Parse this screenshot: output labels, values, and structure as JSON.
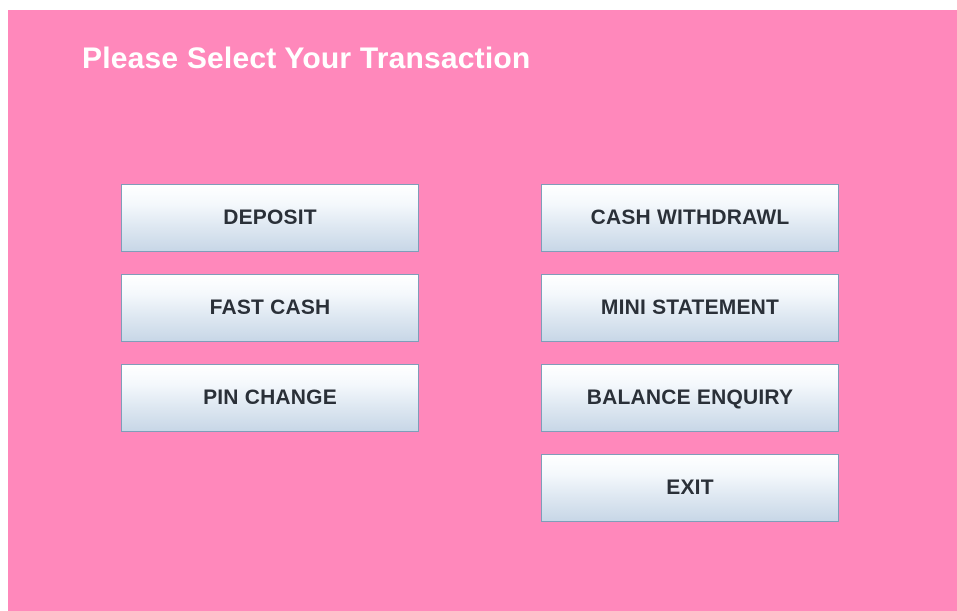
{
  "header": {
    "title": "Please Select Your Transaction"
  },
  "buttons": {
    "deposit": "DEPOSIT",
    "cash_withdrawl": "CASH WITHDRAWL",
    "fast_cash": "FAST CASH",
    "mini_statement": "MINI STATEMENT",
    "pin_change": "PIN CHANGE",
    "balance_enquiry": "BALANCE ENQUIRY",
    "exit": "EXIT"
  },
  "colors": {
    "background": "#ff88bb",
    "title_text": "#ffffff",
    "button_text": "#2a3038",
    "button_border": "#7f9db9"
  }
}
